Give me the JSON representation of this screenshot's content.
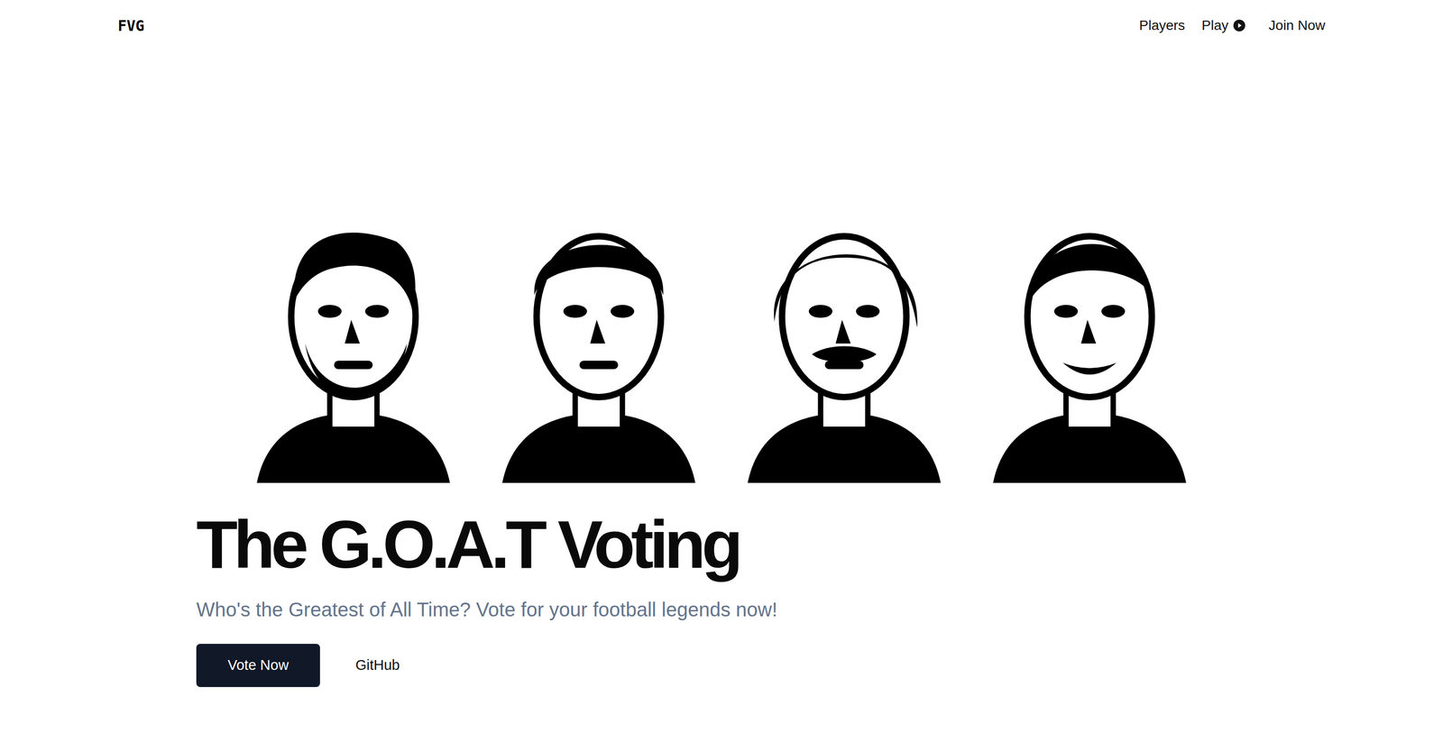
{
  "nav": {
    "logo": "FVG",
    "links": [
      {
        "label": "Players",
        "icon": false
      },
      {
        "label": "Play",
        "icon": true
      }
    ],
    "cta": "Join Now"
  },
  "hero": {
    "title": "The G.O.A.T Voting",
    "subtitle": "Who's the Greatest of All Time? Vote for your football legends now!",
    "primary_button": "Vote Now",
    "secondary_button": "GitHub"
  }
}
